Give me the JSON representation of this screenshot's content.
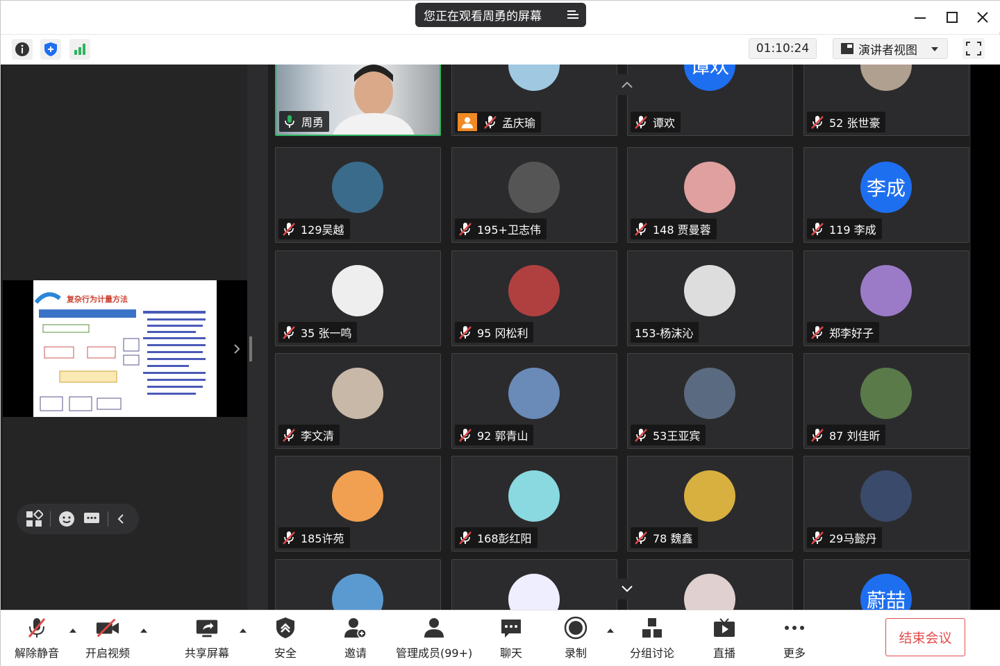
{
  "titlebar": {
    "title": "您正在观看周勇的屏幕",
    "minimize_icon": "minimize-icon",
    "maximize_icon": "maximize-icon",
    "close_icon": "close-icon"
  },
  "toolbar": {
    "info_icon": "info-icon",
    "security_icon": "shield-icon",
    "signal_icon": "signal-bars-icon",
    "timer": "01:10:24",
    "view_mode": "演讲者视图",
    "fullscreen_icon": "fullscreen-icon"
  },
  "shared_slide": {
    "title": "复杂行为计量方法"
  },
  "participants": [
    {
      "name": "周勇",
      "mic": "on",
      "avatar_type": "video",
      "active": true
    },
    {
      "name": "孟庆瑜",
      "mic": "muted",
      "avatar_type": "image",
      "host_badge": true
    },
    {
      "name": "谭欢",
      "mic": "muted",
      "avatar_type": "text",
      "avatar_text": "谭欢"
    },
    {
      "name": "52 张世豪",
      "mic": "muted",
      "avatar_type": "image"
    },
    {
      "name": "129吴越",
      "mic": "muted",
      "avatar_type": "image"
    },
    {
      "name": "195+卫志伟",
      "mic": "muted",
      "avatar_type": "image"
    },
    {
      "name": "148 贾曼蓉",
      "mic": "muted",
      "avatar_type": "image"
    },
    {
      "name": "119 李成",
      "mic": "muted",
      "avatar_type": "text",
      "avatar_text": "李成"
    },
    {
      "name": "35 张一鸣",
      "mic": "muted",
      "avatar_type": "image"
    },
    {
      "name": "95 冈松利",
      "mic": "muted",
      "avatar_type": "image"
    },
    {
      "name": "153-杨沫沁",
      "mic": "none",
      "avatar_type": "image"
    },
    {
      "name": "郑李好子",
      "mic": "muted",
      "avatar_type": "image"
    },
    {
      "name": "李文清",
      "mic": "muted",
      "avatar_type": "image"
    },
    {
      "name": "92 郭青山",
      "mic": "muted",
      "avatar_type": "image"
    },
    {
      "name": "53王亚宾",
      "mic": "muted",
      "avatar_type": "image"
    },
    {
      "name": "87 刘佳昕",
      "mic": "muted",
      "avatar_type": "image"
    },
    {
      "name": "185许苑",
      "mic": "muted",
      "avatar_type": "image"
    },
    {
      "name": "168彭红阳",
      "mic": "muted",
      "avatar_type": "image"
    },
    {
      "name": "78 魏鑫",
      "mic": "muted",
      "avatar_type": "image"
    },
    {
      "name": "29马懿丹",
      "mic": "muted",
      "avatar_type": "image"
    },
    {
      "name": "",
      "mic": "none",
      "avatar_type": "image"
    },
    {
      "name": "",
      "mic": "none",
      "avatar_type": "image"
    },
    {
      "name": "",
      "mic": "none",
      "avatar_type": "image"
    },
    {
      "name": "",
      "mic": "none",
      "avatar_type": "text",
      "avatar_text": "蔚喆"
    }
  ],
  "bottombar": {
    "unmute": "解除静音",
    "start_video": "开启视频",
    "share_screen": "共享屏幕",
    "security": "安全",
    "invite": "邀请",
    "manage_members": "管理成员(99+)",
    "chat": "聊天",
    "record": "录制",
    "breakout": "分组讨论",
    "live": "直播",
    "more": "更多",
    "end_meeting": "结束会议"
  },
  "colors": {
    "accent_blue": "#1e6ff0",
    "end_red": "#e24c4c",
    "active_green": "#2db360",
    "muted_red": "#e04848"
  }
}
